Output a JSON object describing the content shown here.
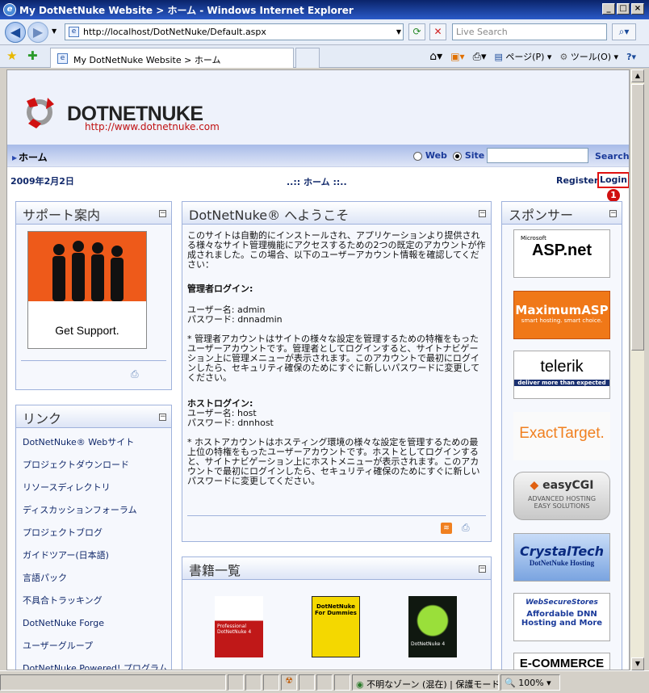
{
  "window": {
    "title": "My DotNetNuke Website > ホーム - Windows Internet Explorer"
  },
  "browser": {
    "address": "http://localhost/DotNetNuke/Default.aspx",
    "search_placeholder": "Live Search",
    "tab_title": "My DotNetNuke Website > ホーム",
    "page_menu": "ページ(P)",
    "tools_menu": "ツール(O)"
  },
  "site": {
    "brand": "DOTNETNUKE",
    "url": "http://www.dotnetnuke.com",
    "menu_home": "ホーム",
    "search_web": "Web",
    "search_site": "Site",
    "search_button": "Search",
    "date": "2009年2月2日",
    "breadcrumb": "..:: ホーム ::..",
    "register": "Register",
    "login": "Login",
    "marker": "1"
  },
  "support": {
    "title": "サポート案内",
    "image_caption": "Get Support."
  },
  "links": {
    "title": "リンク",
    "items": [
      "DotNetNuke® Webサイト",
      "プロジェクトダウンロード",
      "リソースディレクトリ",
      "ディスカッションフォーラム",
      "プロジェクトブログ",
      "ガイドツアー(日本語)",
      "言語パック",
      "不具合トラッキング",
      "DotNetNuke Forge",
      "ユーザーグループ",
      "DotNetNuke Powered! プログラム"
    ]
  },
  "welcome": {
    "title": "DotNetNuke® へようこそ",
    "intro": "このサイトは自動的にインストールされ、アプリケーションより提供される様々なサイト管理機能にアクセスするための2つの既定のアカウントが作成されました。この場合、以下のユーザーアカウント情報を確認してください：",
    "admin_heading": "管理者ログイン:",
    "admin_user": "ユーザー名: admin",
    "admin_pass": "パスワード: dnnadmin",
    "admin_note": "* 管理者アカウントはサイトの様々な設定を管理するための特権をもったユーザーアカウントです。管理者としてログインすると、サイトナビゲーション上に管理メニューが表示されます。このアカウントで最初にログインしたら、セキュリティ確保のためにすぐに新しいパスワードに変更してください。",
    "host_heading": "ホストログイン:",
    "host_user": "ユーザー名: host",
    "host_pass": "パスワード: dnnhost",
    "host_note": "* ホストアカウントはホスティング環境の様々な設定を管理するための最上位の特権をもったユーザーアカウントです。ホストとしてログインすると、サイトナビゲーション上にホストメニューが表示されます。このアカウントで最初にログインしたら、セキュリティ確保のためにすぐに新しいパスワードに変更してください。"
  },
  "books": {
    "title": "書籍一覧",
    "items": [
      "Professional DotNetNuke 4",
      "DotNetNuke For Dummies",
      "DotNetNuke 4"
    ]
  },
  "sponsors": {
    "title": "スポンサー",
    "items": [
      "ASP.net",
      "MaximumASP",
      "telerik",
      "ExactTarget.",
      "easyCGI",
      "CrystalTech",
      "WebSecureStores",
      "E-COMMERCE"
    ],
    "aspnet_top": "Microsoft",
    "maximum_sub": "smart hosting. smart choice.",
    "telerik_sub": "deliver more than expected",
    "easycgi_sub1": "ADVANCED HOSTING",
    "easycgi_sub2": "EASY SOLUTIONS",
    "crystal_sub": "DotNetNuke Hosting",
    "websecure_sub": "Affordable DNN Hosting and More"
  },
  "status": {
    "zone": "不明なゾーン (混在) | 保護モード: 無効",
    "zoom": "100%"
  },
  "colors": {
    "accent": "#10286a",
    "login_highlight": "#e01010"
  }
}
